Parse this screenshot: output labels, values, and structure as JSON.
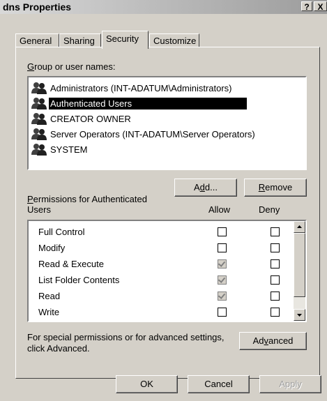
{
  "window": {
    "title": "dns Properties",
    "help_glyph": "?",
    "close_glyph": "X"
  },
  "tabs": [
    {
      "label": "General"
    },
    {
      "label": "Sharing"
    },
    {
      "label": "Security"
    },
    {
      "label": "Customize"
    }
  ],
  "groups": {
    "label": "Group or user names:",
    "items": [
      {
        "label": "Administrators (INT-ADATUM\\Administrators)",
        "icon": "user-group-icon"
      },
      {
        "label": "Authenticated Users",
        "icon": "user-group-icon",
        "selected": true
      },
      {
        "label": "CREATOR OWNER",
        "icon": "user-group-icon"
      },
      {
        "label": "Server Operators (INT-ADATUM\\Server Operators)",
        "icon": "user-group-icon"
      },
      {
        "label": "SYSTEM",
        "icon": "user-group-icon"
      }
    ],
    "add_button": "Add...",
    "remove_button": "Remove"
  },
  "permissions": {
    "label_line1": "Permissions for Authenticated",
    "label_line2": "Users",
    "allow_header": "Allow",
    "deny_header": "Deny",
    "rows": [
      {
        "label": "Full Control",
        "allow": false,
        "allow_disabled": false,
        "deny": false
      },
      {
        "label": "Modify",
        "allow": false,
        "allow_disabled": false,
        "deny": false
      },
      {
        "label": "Read & Execute",
        "allow": true,
        "allow_disabled": true,
        "deny": false
      },
      {
        "label": "List Folder Contents",
        "allow": true,
        "allow_disabled": true,
        "deny": false
      },
      {
        "label": "Read",
        "allow": true,
        "allow_disabled": true,
        "deny": false
      },
      {
        "label": "Write",
        "allow": false,
        "allow_disabled": false,
        "deny": false
      }
    ]
  },
  "advanced": {
    "text_line1": "For special permissions or for advanced settings,",
    "text_line2": "click Advanced.",
    "button": "Advanced"
  },
  "footer": {
    "ok": "OK",
    "cancel": "Cancel",
    "apply": "Apply"
  }
}
